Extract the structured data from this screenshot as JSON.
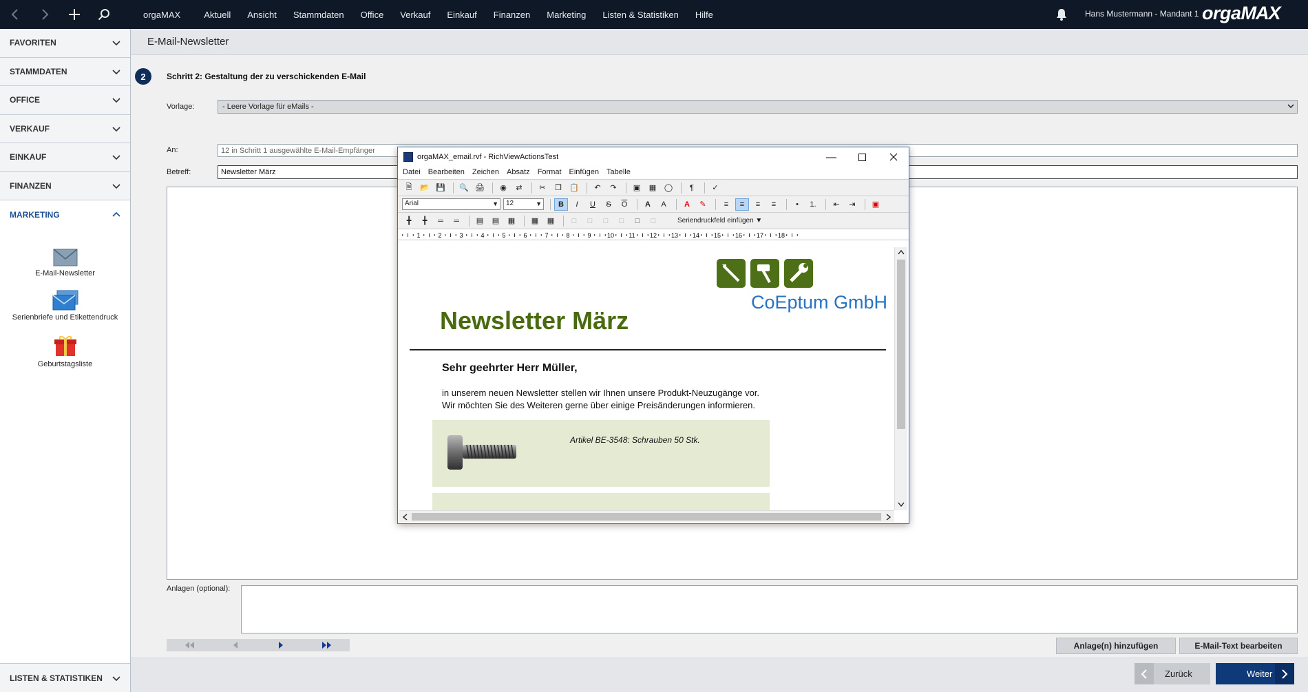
{
  "topbar": {
    "menu": [
      "orgaMAX",
      "Aktuell",
      "Ansicht",
      "Stammdaten",
      "Office",
      "Verkauf",
      "Einkauf",
      "Finanzen",
      "Marketing",
      "Listen & Statistiken",
      "Hilfe"
    ],
    "user": "Hans Mustermann - Mandant 1",
    "logo_orga": "orga",
    "logo_max": "MAX"
  },
  "sidebar": {
    "sections": [
      "FAVORITEN",
      "STAMMDATEN",
      "OFFICE",
      "VERKAUF",
      "EINKAUF",
      "FINANZEN",
      "MARKETING"
    ],
    "marketing_items": [
      "E-Mail-Newsletter",
      "Serienbriefe und Etikettendruck",
      "Geburtstagsliste"
    ],
    "bottom": "LISTEN & STATISTIKEN"
  },
  "main": {
    "title": "E-Mail-Newsletter",
    "step_number": "2",
    "step_title": "Schritt 2: Gestaltung der zu verschickenden E-Mail",
    "vorlage_label": "Vorlage:",
    "vorlage_value": "- Leere Vorlage für eMails -",
    "an_label": "An:",
    "an_value": "12 in Schritt 1 ausgewählte E-Mail-Empfänger",
    "betreff_label": "Betreff:",
    "betreff_value": "Newsletter März",
    "anlagen_label": "Anlagen (optional):",
    "btn_add_attachment": "Anlage(n) hinzufügen",
    "btn_edit_text": "E-Mail-Text bearbeiten",
    "btn_back": "Zurück",
    "btn_next": "Weiter"
  },
  "editor": {
    "title": "orgaMAX_email.rvf - RichViewActionsTest",
    "menu": [
      "Datei",
      "Bearbeiten",
      "Zeichen",
      "Absatz",
      "Format",
      "Einfügen",
      "Tabelle"
    ],
    "font": "Arial",
    "size": "12",
    "serien": "Seriendruckfeld einfügen",
    "ruler_numbers": [
      "1",
      "2",
      "3",
      "4",
      "5",
      "6",
      "7",
      "8",
      "9",
      "10",
      "11",
      "12",
      "13",
      "14",
      "15",
      "16",
      "17",
      "18"
    ]
  },
  "doc": {
    "heading": "Newsletter März",
    "company": "CoEptum GmbH",
    "greeting": "Sehr geehrter Herr Müller,",
    "para1": "in unserem neuen Newsletter stellen wir Ihnen unsere Produkt-Neuzugänge vor.",
    "para2": "Wir möchten Sie des Weiteren gerne über einige Preisänderungen informieren.",
    "product_caption": "Artikel BE-3548: Schrauben 50 Stk."
  },
  "colors": {
    "topbar": "#0e1826",
    "brand_green": "#4a6a10",
    "brand_blue": "#2773c2",
    "primary_button": "#0f3a7a"
  }
}
